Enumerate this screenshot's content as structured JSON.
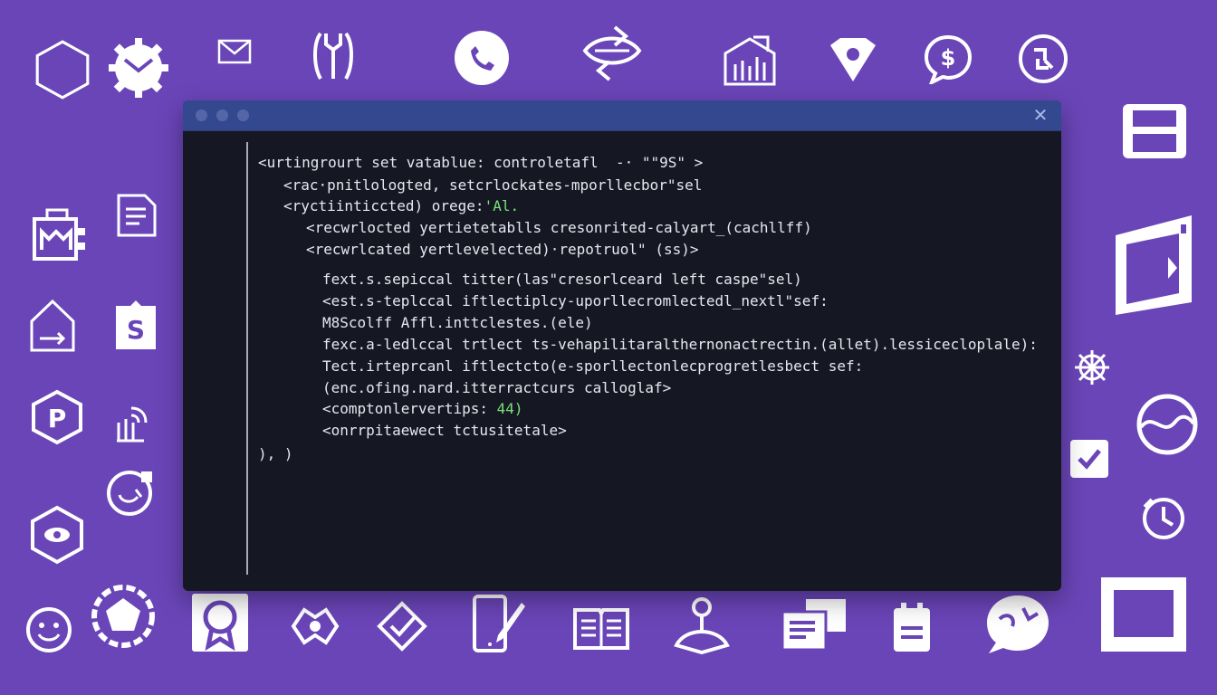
{
  "terminal": {
    "title_controls": [
      "close"
    ],
    "close_glyph": "✕",
    "lines": [
      {
        "text": "<urtingrourt set vatablue: controletafl  -· \"\"9S\" >",
        "highlight": ""
      },
      {
        "text": "<rac·pnitlologted, setcrlockates-mporllecbor\"sel",
        "highlight": ""
      },
      {
        "text": "<ryctiinticcted) orege:",
        "highlight": "'Al."
      },
      {
        "text": "<recwrlocted yertietetablls cresonrited-calyart_(cachllff)",
        "highlight": ""
      },
      {
        "text": "<recwrlcated yertlevelected)·repotruol\" (ss)>",
        "highlight": ""
      },
      {
        "text": "fext.s.sepiccal titter(las\"cresorlceard left caspe\"sel)",
        "highlight": ""
      },
      {
        "text": "<est.s-teplccal iftlectiplcy-uporllecromlectedl_nextl\"sef:",
        "highlight": ""
      },
      {
        "text": "M8Scolff Affl.inttclestes.(ele)",
        "highlight": ""
      },
      {
        "text": "fexc.a-ledlccal trtlect ts-vehapilitaralthernonactrectin.(allet).lessiceclo­plale):",
        "highlight": ""
      },
      {
        "text": "Tect.irteprcanl iftlectcto(e-sporllectonlecprogretlesbect sef:",
        "highlight": ""
      },
      {
        "text": "(enc.ofing.nard.itterractcurs calloglaf>",
        "highlight": ""
      },
      {
        "text": "<comptonlervertips: ",
        "highlight": "44)"
      },
      {
        "text": "<onrrpitaewect tctusitetale>",
        "highlight": ""
      },
      {
        "text": "), )",
        "highlight": ""
      }
    ]
  },
  "icons": [
    "hexagon-icon",
    "gear-envelope-icon",
    "envelope-icon",
    "wrench-icon",
    "phone-chat-icon",
    "ticket-icon",
    "chart-envelope-icon",
    "diamond-location-icon",
    "dollar-chat-icon",
    "share-icon",
    "archive-icon",
    "bank-icon",
    "document-icon",
    "home-arrow-icon",
    "dollar-badge-icon",
    "parking-icon",
    "wifi-hand-icon",
    "chat-refresh-icon",
    "eye-hexagon-icon",
    "smile-icon",
    "pentagon-gear-icon",
    "award-icon",
    "eye-ticket-icon",
    "check-shield-icon",
    "tablet-pen-icon",
    "book-icon",
    "location-hand-icon",
    "tickets-icon",
    "calendar-clip-icon",
    "globe-chat-icon",
    "door-icon",
    "network-icon",
    "globe-icon",
    "checkbox-icon",
    "clock-icon",
    "frame-icon"
  ]
}
